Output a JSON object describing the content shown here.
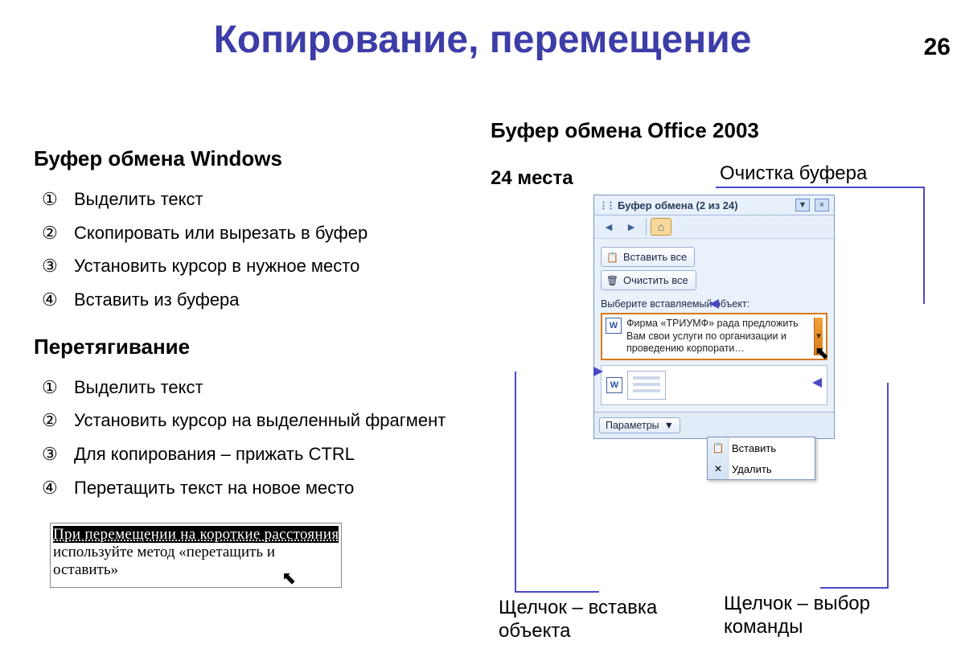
{
  "page_number": "26",
  "title": "Копирование, перемещение",
  "left": {
    "section1_title": "Буфер обмена Windows",
    "section1_items": [
      "Выделить текст",
      "Скопировать или вырезать в буфер",
      "Установить курсор в нужное место",
      "Вставить из буфера"
    ],
    "section2_title": "Перетягивание",
    "section2_items": [
      "Выделить текст",
      "Установить курсор на выделенный фрагмент",
      "Для копирования – прижать CTRL",
      "Перетащить текст на новое место"
    ],
    "drag_example_line1": "При перемещении на короткие расстояния",
    "drag_example_line2a": "используйте метод «перетащить и",
    "drag_example_line3a": "оставить»"
  },
  "right": {
    "section_title": "Буфер обмена Office 2003",
    "subhead": "24 места",
    "annot_clear": "Очистка буфера",
    "annot_click_insert": "Щелчок – вставка объекта",
    "annot_click_menu": "Щелчок – выбор команды"
  },
  "pane": {
    "title": "Буфер обмена (2 из 24)",
    "paste_all": "Вставить все",
    "clear_all": "Очистить все",
    "select_label": "Выберите вставляемый объект:",
    "clip1_text": "Фирма «ТРИУМФ» рада предложить Вам свои услуги по организации и проведению корпорати…",
    "menu_paste": "Вставить",
    "menu_delete": "Удалить",
    "options": "Параметры"
  },
  "bullets": [
    "①",
    "②",
    "③",
    "④"
  ]
}
